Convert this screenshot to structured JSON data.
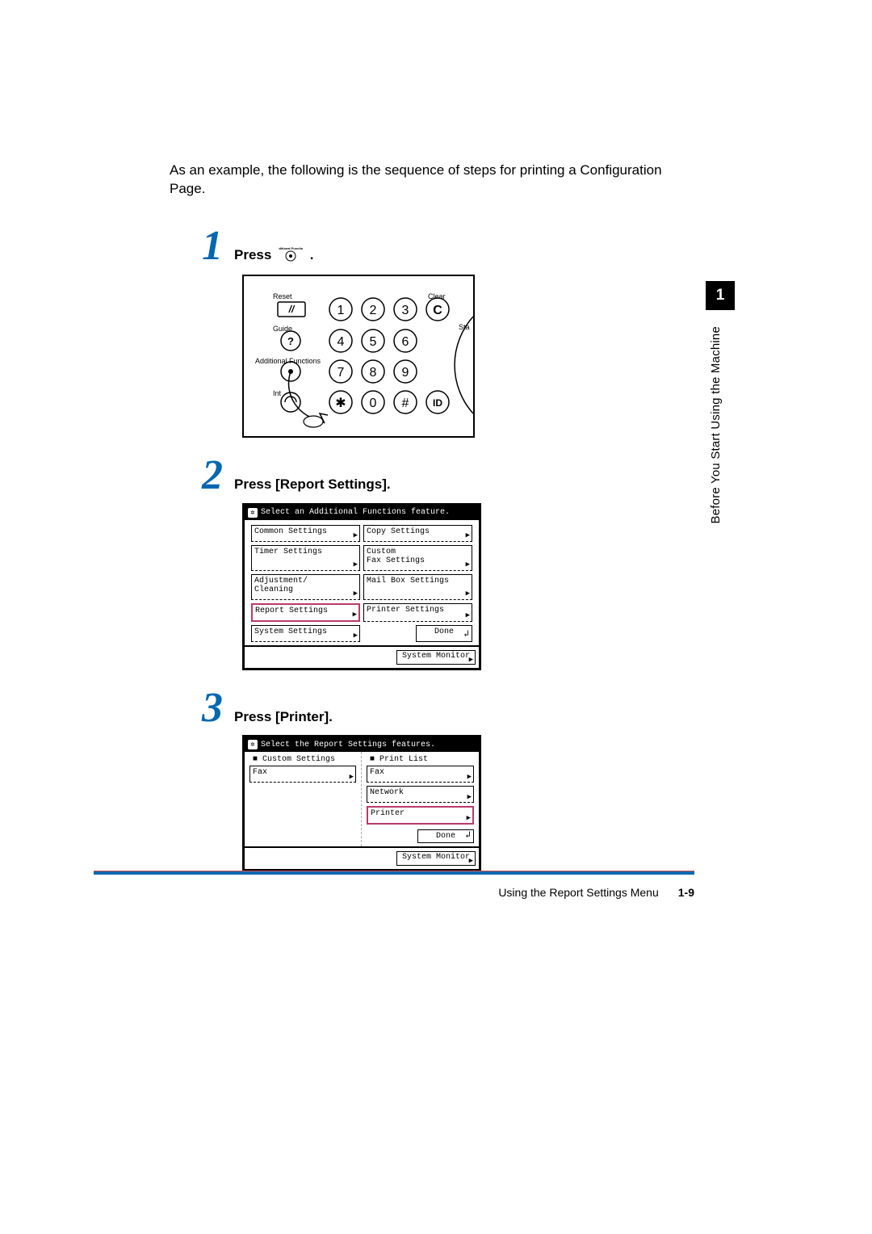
{
  "intro": "As an example, the following is the sequence of steps for printing a Configuration Page.",
  "steps": {
    "s1": {
      "num": "1",
      "text_a": "Press ",
      "text_b": " ."
    },
    "s2": {
      "num": "2",
      "text": "Press [Report Settings]."
    },
    "s3": {
      "num": "3",
      "text": "Press [Printer]."
    }
  },
  "keypad": {
    "reset": "Reset",
    "guide": "Guide",
    "additional_functions": "Additional Functions",
    "interrupt": "Int",
    "clear": "Clear",
    "start": "Sta",
    "keys": {
      "1": "1",
      "2": "2",
      "3": "3",
      "4": "4",
      "5": "5",
      "6": "6",
      "7": "7",
      "8": "8",
      "9": "9",
      "0": "0",
      "star": "✱",
      "hash": "#",
      "c": "C",
      "id": "ID",
      "q": "?",
      "slashes": "//"
    }
  },
  "screen2": {
    "title": "Select an Additional Functions feature.",
    "btns": {
      "common": "Common Settings",
      "copy": "Copy Settings",
      "timer": "Timer Settings",
      "custom_fax": "Custom\nFax Settings",
      "adjust": "Adjustment/\nCleaning",
      "mailbox": "Mail Box Settings",
      "report": "Report Settings",
      "printer": "Printer Settings",
      "system": "System Settings"
    },
    "done": "Done",
    "sysmon": "System Monitor"
  },
  "screen3": {
    "title": "Select the Report Settings features.",
    "col_custom": "■ Custom Settings",
    "col_print": "■ Print List",
    "fax1": "Fax",
    "fax2": "Fax",
    "network": "Network",
    "printer": "Printer",
    "done": "Done",
    "sysmon": "System Monitor"
  },
  "footer": {
    "title": "Using the Report Settings Menu",
    "page": "1-9"
  },
  "side": {
    "chapter": "1",
    "vtext": "Before You Start Using the Machine"
  },
  "icon_label": "Additional Functions"
}
